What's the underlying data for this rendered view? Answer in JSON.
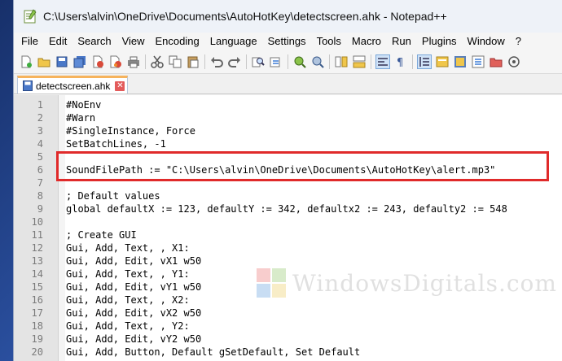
{
  "window": {
    "title": "C:\\Users\\alvin\\OneDrive\\Documents\\AutoHotKey\\detectscreen.ahk - Notepad++"
  },
  "menu": [
    "File",
    "Edit",
    "Search",
    "View",
    "Encoding",
    "Language",
    "Settings",
    "Tools",
    "Macro",
    "Run",
    "Plugins",
    "Window",
    "?"
  ],
  "toolbar": {
    "icons": [
      "new-file-icon",
      "open-file-icon",
      "save-icon",
      "save-all-icon",
      "close-icon",
      "close-all-icon",
      "print-icon",
      "cut-icon",
      "copy-icon",
      "paste-icon",
      "undo-icon",
      "redo-icon",
      "find-icon",
      "replace-icon",
      "zoom-in-icon",
      "zoom-out-icon",
      "sync-vertical-icon",
      "sync-horizontal-icon",
      "word-wrap-icon",
      "show-all-chars-icon",
      "indent-guide-icon",
      "user-language-icon",
      "document-map-icon",
      "function-list-icon",
      "folder-workspace-icon",
      "monitor-icon"
    ]
  },
  "tab": {
    "label": "detectscreen.ahk",
    "close": "✕"
  },
  "editor": {
    "lines": [
      {
        "n": "1",
        "text": "#NoEnv"
      },
      {
        "n": "2",
        "text": "#Warn"
      },
      {
        "n": "3",
        "text": "#SingleInstance, Force"
      },
      {
        "n": "4",
        "text": "SetBatchLines, -1"
      },
      {
        "n": "5",
        "text": ""
      },
      {
        "n": "6",
        "text": "SoundFilePath := \"C:\\Users\\alvin\\OneDrive\\Documents\\AutoHotKey\\alert.mp3\""
      },
      {
        "n": "7",
        "text": ""
      },
      {
        "n": "8",
        "text": "; Default values"
      },
      {
        "n": "9",
        "text": "global defaultX := 123, defaultY := 342, defaultx2 := 243, defaulty2 := 548"
      },
      {
        "n": "10",
        "text": ""
      },
      {
        "n": "11",
        "text": "; Create GUI"
      },
      {
        "n": "12",
        "text": "Gui, Add, Text, , X1:"
      },
      {
        "n": "13",
        "text": "Gui, Add, Edit, vX1 w50"
      },
      {
        "n": "14",
        "text": "Gui, Add, Text, , Y1:"
      },
      {
        "n": "15",
        "text": "Gui, Add, Edit, vY1 w50"
      },
      {
        "n": "16",
        "text": "Gui, Add, Text, , X2:"
      },
      {
        "n": "17",
        "text": "Gui, Add, Edit, vX2 w50"
      },
      {
        "n": "18",
        "text": "Gui, Add, Text, , Y2:"
      },
      {
        "n": "19",
        "text": "Gui, Add, Edit, vY2 w50"
      },
      {
        "n": "20",
        "text": "Gui, Add, Button, Default gSetDefault, Set Default"
      }
    ]
  },
  "watermark": {
    "text": "WindowsDigitals.com"
  }
}
